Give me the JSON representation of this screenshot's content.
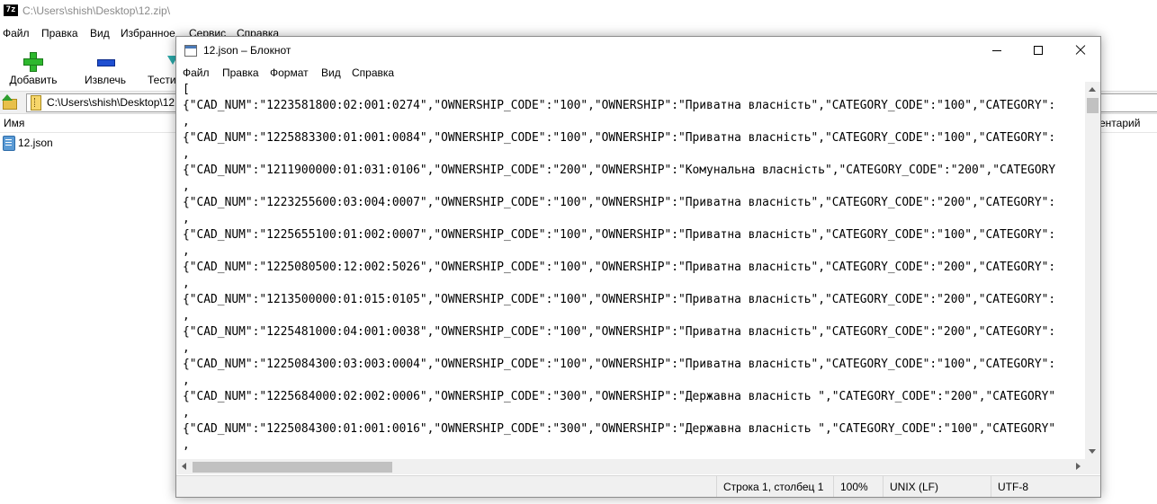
{
  "background_window": {
    "title": "C:\\Users\\shish\\Desktop\\12.zip\\",
    "logo_text": "7z",
    "menu": [
      "Файл",
      "Правка",
      "Вид",
      "Избранное",
      "Сервис",
      "Справка"
    ],
    "toolbar": {
      "add_label": "Добавить",
      "extract_label": "Извлечь",
      "test_label": "Тести"
    },
    "address": "C:\\Users\\shish\\Desktop\\12",
    "columns": {
      "name": "Имя",
      "comment": "ентарий"
    },
    "files": [
      {
        "name": "12.json"
      }
    ]
  },
  "notepad": {
    "title": "12.json – Блокнот",
    "menu": [
      "Файл",
      "Правка",
      "Формат",
      "Вид",
      "Справка"
    ],
    "lines": [
      "[",
      "{\"CAD_NUM\":\"1223581800:02:001:0274\",\"OWNERSHIP_CODE\":\"100\",\"OWNERSHIP\":\"Приватна власність\",\"CATEGORY_CODE\":\"100\",\"CATEGORY\":",
      ",",
      "{\"CAD_NUM\":\"1225883300:01:001:0084\",\"OWNERSHIP_CODE\":\"100\",\"OWNERSHIP\":\"Приватна власність\",\"CATEGORY_CODE\":\"100\",\"CATEGORY\":",
      ",",
      "{\"CAD_NUM\":\"1211900000:01:031:0106\",\"OWNERSHIP_CODE\":\"200\",\"OWNERSHIP\":\"Комунальна власність\",\"CATEGORY_CODE\":\"200\",\"CATEGORY",
      ",",
      "{\"CAD_NUM\":\"1223255600:03:004:0007\",\"OWNERSHIP_CODE\":\"100\",\"OWNERSHIP\":\"Приватна власність\",\"CATEGORY_CODE\":\"200\",\"CATEGORY\":",
      ",",
      "{\"CAD_NUM\":\"1225655100:01:002:0007\",\"OWNERSHIP_CODE\":\"100\",\"OWNERSHIP\":\"Приватна власність\",\"CATEGORY_CODE\":\"100\",\"CATEGORY\":",
      ",",
      "{\"CAD_NUM\":\"1225080500:12:002:5026\",\"OWNERSHIP_CODE\":\"100\",\"OWNERSHIP\":\"Приватна власність\",\"CATEGORY_CODE\":\"200\",\"CATEGORY\":",
      ",",
      "{\"CAD_NUM\":\"1213500000:01:015:0105\",\"OWNERSHIP_CODE\":\"100\",\"OWNERSHIP\":\"Приватна власність\",\"CATEGORY_CODE\":\"200\",\"CATEGORY\":",
      ",",
      "{\"CAD_NUM\":\"1225481000:04:001:0038\",\"OWNERSHIP_CODE\":\"100\",\"OWNERSHIP\":\"Приватна власність\",\"CATEGORY_CODE\":\"200\",\"CATEGORY\":",
      ",",
      "{\"CAD_NUM\":\"1225084300:03:003:0004\",\"OWNERSHIP_CODE\":\"100\",\"OWNERSHIP\":\"Приватна власність\",\"CATEGORY_CODE\":\"100\",\"CATEGORY\":",
      ",",
      "{\"CAD_NUM\":\"1225684000:02:002:0006\",\"OWNERSHIP_CODE\":\"300\",\"OWNERSHIP\":\"Державна власність \",\"CATEGORY_CODE\":\"200\",\"CATEGORY\"",
      ",",
      "{\"CAD_NUM\":\"1225084300:01:001:0016\",\"OWNERSHIP_CODE\":\"300\",\"OWNERSHIP\":\"Державна власність \",\"CATEGORY_CODE\":\"100\",\"CATEGORY\"",
      ","
    ],
    "status": {
      "position": "Строка 1, столбец 1",
      "zoom": "100%",
      "line_endings": "UNIX (LF)",
      "encoding": "UTF-8"
    }
  }
}
